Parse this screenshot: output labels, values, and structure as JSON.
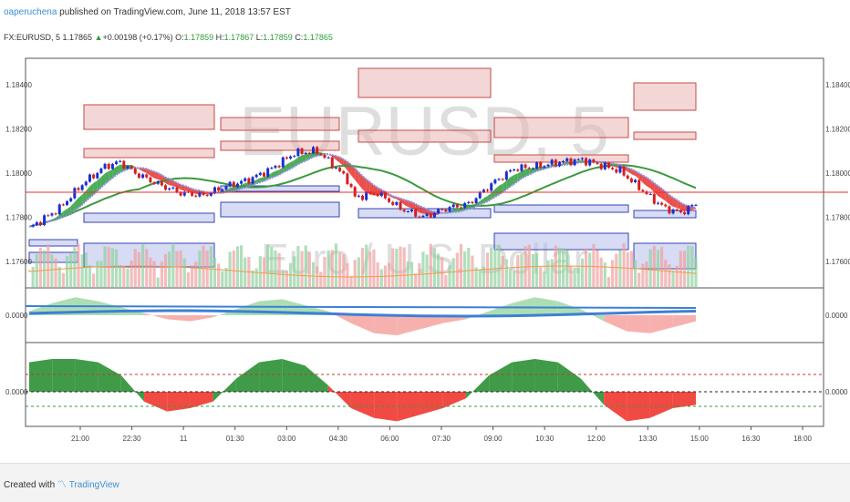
{
  "header": {
    "author": "oaperuchena",
    "published_text": "published on TradingView.com, June 11, 2018 13:57 EST"
  },
  "ticker": {
    "symbol": "FX:EURUSD, 5",
    "last": "1.17865",
    "change": "+0.00198 (+0.17%)",
    "o_label": "O:",
    "o_value": "1.17859",
    "h_label": "H:",
    "h_value": "1.17867",
    "l_label": "L:",
    "l_value": "1.17859",
    "c_label": "C:",
    "c_value": "1.17865"
  },
  "watermark": {
    "symbol": "EURUSD, 5",
    "name": "Euro / U.S. Dollar"
  },
  "footer": {
    "created_with": "Created with",
    "brand": "TradingView"
  },
  "colors": {
    "up": "#2e9e3a",
    "down": "#e8302a",
    "accent": "#3d8fd6",
    "price_line": "#e8302a"
  },
  "chart_data": [
    {
      "type": "candlestick",
      "pane": "price",
      "y_tick_labels": [
        "1.18400",
        "1.18200",
        "1.18000",
        "1.17800",
        "1.17600"
      ],
      "ylim": [
        1.1748,
        1.1852
      ],
      "close_approx": [
        [
          0,
          1.1775
        ],
        [
          8,
          1.1784
        ],
        [
          14,
          1.1795
        ],
        [
          20,
          1.1803
        ],
        [
          24,
          1.1805
        ],
        [
          28,
          1.18
        ],
        [
          34,
          1.1795
        ],
        [
          40,
          1.1791
        ],
        [
          46,
          1.179
        ],
        [
          52,
          1.1794
        ],
        [
          58,
          1.1797
        ],
        [
          64,
          1.1802
        ],
        [
          70,
          1.1809
        ],
        [
          76,
          1.181
        ],
        [
          80,
          1.1804
        ],
        [
          84,
          1.1797
        ],
        [
          86,
          1.1789
        ],
        [
          92,
          1.1791
        ],
        [
          98,
          1.1784
        ],
        [
          104,
          1.178
        ],
        [
          110,
          1.1784
        ],
        [
          116,
          1.1786
        ],
        [
          122,
          1.1795
        ],
        [
          128,
          1.1802
        ],
        [
          134,
          1.1803
        ],
        [
          140,
          1.1805
        ],
        [
          146,
          1.1806
        ],
        [
          150,
          1.1804
        ],
        [
          156,
          1.1801
        ],
        [
          160,
          1.1795
        ],
        [
          164,
          1.1789
        ],
        [
          168,
          1.1784
        ],
        [
          172,
          1.1782
        ],
        [
          176,
          1.1786
        ]
      ],
      "x_tick_labels": [
        "21:00",
        "22:30",
        "11",
        "01:30",
        "03:00",
        "04:30",
        "06:00",
        "07:30",
        "09:00",
        "10:30",
        "12:00",
        "13:30",
        "15:00",
        "16:30",
        "18:00"
      ]
    },
    {
      "type": "area",
      "pane": "oscillator-1",
      "y_tick_labels": [
        "0.0000"
      ],
      "series": [
        {
          "values": [
            0.2,
            0.6,
            0.9,
            0.7,
            0.4,
            0.1,
            -0.2,
            -0.3,
            -0.1,
            0.3,
            0.7,
            0.8,
            0.5,
            0.2,
            -0.4,
            -0.9,
            -1.0,
            -0.7,
            -0.4,
            -0.2,
            0.2,
            0.6,
            0.9,
            0.7,
            0.3,
            -0.3,
            -0.8,
            -0.9,
            -0.6,
            -0.3
          ]
        }
      ]
    },
    {
      "type": "area",
      "pane": "oscillator-2",
      "y_tick_labels": [
        "0.0000"
      ],
      "series": [
        {
          "values": [
            0.9,
            1.0,
            1.0,
            0.9,
            0.5,
            -0.3,
            -0.6,
            -0.5,
            -0.3,
            0.4,
            0.9,
            1.0,
            0.8,
            0.2,
            -0.5,
            -0.8,
            -0.9,
            -0.7,
            -0.5,
            -0.2,
            0.5,
            0.9,
            1.0,
            0.9,
            0.4,
            -0.4,
            -0.9,
            -0.8,
            -0.5,
            -0.4
          ]
        }
      ]
    }
  ]
}
